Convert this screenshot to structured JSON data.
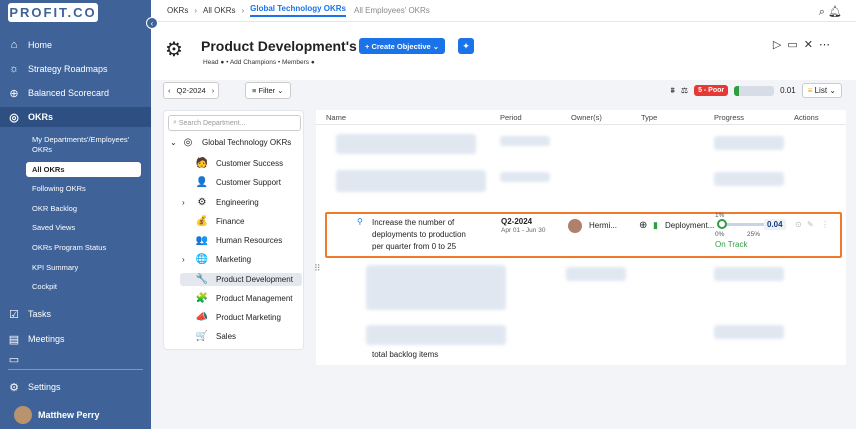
{
  "brand": {
    "logo": "PROFIT.CO",
    "accent": "#3f6399",
    "link": "#1a73e8",
    "highlight": "#f07a29"
  },
  "sidebar": {
    "items": [
      {
        "label": "Home",
        "icon": "home-icon"
      },
      {
        "label": "Strategy Roadmaps",
        "icon": "roadmap-icon"
      },
      {
        "label": "Balanced Scorecard",
        "icon": "scorecard-icon"
      },
      {
        "label": "OKRs",
        "icon": "target-icon"
      }
    ],
    "okr_sub": [
      "My Departments'/Employees' OKRs",
      "All OKRs",
      "Following OKRs",
      "OKR Backlog",
      "Saved Views",
      "OKRs Program Status",
      "KPI Summary",
      "Cockpit"
    ],
    "bottom": [
      {
        "label": "Tasks",
        "icon": "tasks-icon"
      },
      {
        "label": "Meetings",
        "icon": "meetings-icon"
      }
    ],
    "settings": "Settings",
    "user": "Matthew Perry"
  },
  "breadcrumb": {
    "okrs": "OKRs",
    "all": "All OKRs",
    "current": "Global Technology OKRs",
    "other": "All Employees' OKRs"
  },
  "header": {
    "title": "Product Development's OKRs",
    "create": "+ Create Objective",
    "meta_head": "Head",
    "meta_champions": "• Add Champions",
    "meta_members": "• Members"
  },
  "toolbar": {
    "quarter": "Q2-2024",
    "filter": "Filter",
    "status": "5 - Poor",
    "score": "0.01",
    "progress_fill": 0.12,
    "view": "List"
  },
  "tree": {
    "search_placeholder": "Search Department...",
    "root": "Global Technology OKRs",
    "children": [
      "Customer Success",
      "Customer Support",
      "Engineering",
      "Finance",
      "Human Resources",
      "Marketing",
      "Product Development",
      "Product Management",
      "Product Marketing",
      "Sales"
    ]
  },
  "table": {
    "headers": [
      "Name",
      "Period",
      "Owner(s)",
      "Type",
      "Progress",
      "Actions"
    ],
    "row": {
      "name_l1": "Increase the number of",
      "name_l2": "deployments to production",
      "name_l3": "per quarter from 0 to 25",
      "period": "Q2-2024",
      "period_sub": "Apr 01 - Jun 30",
      "owner": "Hermi...",
      "type": "Deployment...",
      "prog_top": "1%",
      "prog_min": "0%",
      "prog_max": "25%",
      "score": "0.04",
      "status": "On Track"
    },
    "trailing": "total backlog items"
  }
}
